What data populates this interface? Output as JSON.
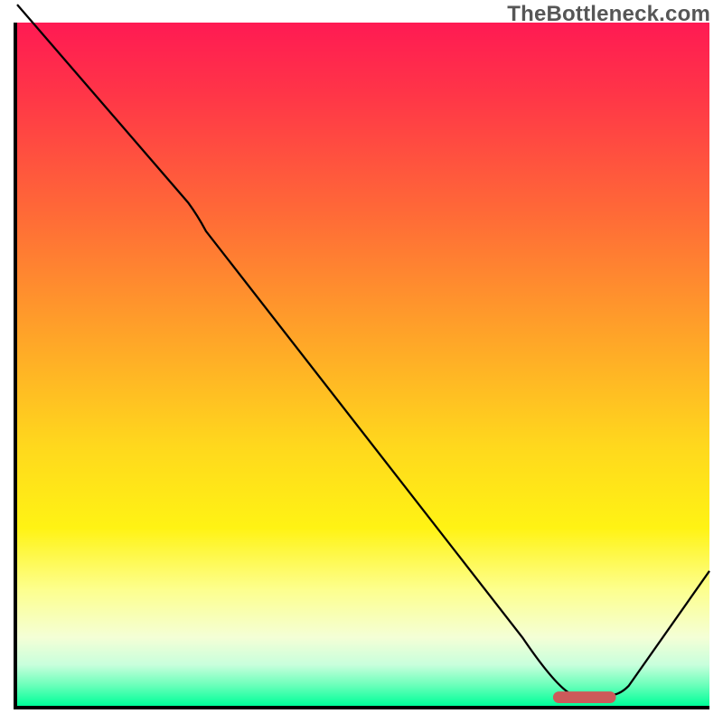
{
  "attribution": "TheBottleneck.com",
  "chart_data": {
    "type": "line",
    "title": "",
    "xlabel": "",
    "ylabel": "",
    "xlim": [
      0,
      100
    ],
    "ylim": [
      0,
      100
    ],
    "x": [
      0,
      10,
      20,
      25,
      35,
      45,
      55,
      65,
      72,
      78,
      82,
      86,
      100
    ],
    "values": [
      102,
      90,
      78,
      73,
      60,
      47,
      34,
      21,
      10,
      3,
      0.5,
      0.5,
      20
    ],
    "marker": {
      "x_start": 78,
      "x_end": 86,
      "y": 0.7
    },
    "gradient_stops": [
      {
        "pct": 0,
        "color": "#ff1a53"
      },
      {
        "pct": 28,
        "color": "#ff6a37"
      },
      {
        "pct": 62,
        "color": "#ffd81d"
      },
      {
        "pct": 90,
        "color": "#f4ffd6"
      },
      {
        "pct": 100,
        "color": "#00ff99"
      }
    ]
  }
}
